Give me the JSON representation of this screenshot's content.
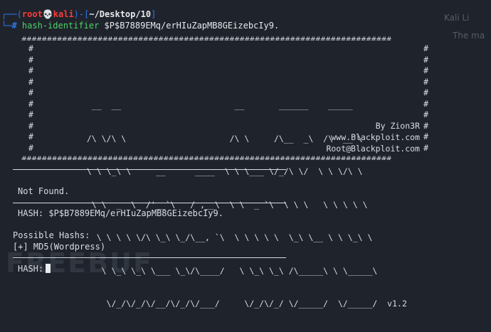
{
  "prompt": {
    "open_bracket": "┌──(",
    "user": "root",
    "skull": "💀",
    "host": "kali",
    "mid": ")-[",
    "path": "~/Desktop/10",
    "close": "]",
    "second_prefix": "└─",
    "dollar": "#",
    "command_name": "hash-identifier",
    "command_arg": "$P$B7889EMq/erHIuZapMB8GEizebcIy9."
  },
  "banner": {
    "hash_line": "#########################################################################",
    "ascii_art": [
      "   __  __                       __       ______    _____",
      "  /\\ \\/\\ \\                     /\\ \\     /\\__  _\\  /\\  __`\\",
      "  \\ \\ \\_\\ \\     __      ____  \\ \\ \\___ \\/_/\\ \\/  \\ \\ \\/\\ \\",
      "   \\ \\  _  \\  /'__`\\   / ,__\\  \\ \\  _ `\\  \\ \\ \\   \\ \\ \\ \\ \\",
      "    \\ \\ \\ \\ \\/\\ \\_\\ \\_/\\__, `\\  \\ \\ \\ \\ \\  \\_\\ \\__ \\ \\ \\_\\ \\",
      "     \\ \\_\\ \\_\\ \\___ \\_\\/\\____/   \\ \\_\\ \\_\\ /\\_____\\ \\ \\_____\\",
      "      \\/_/\\/_/\\/__/\\/_/\\/___/     \\/_/\\/_/ \\/_____/  \\/_____/  v1.2"
    ],
    "by": "By Zion3R",
    "site": "www.Blackploit.com",
    "mail": "Root@Blackploit.com"
  },
  "output": {
    "result": "Not Found.",
    "hash_label": "HASH: $P$B7889EMq/erHIuZapMB8GEizebcIy9.",
    "possible_title": "Possible Hashs:",
    "possible_item": "[+] MD5(Wordpress)",
    "next_prompt": "HASH:"
  },
  "background": {
    "watermark": "FREEBUF",
    "right_text_1": "Kali Li",
    "right_text_2": "The ma"
  }
}
